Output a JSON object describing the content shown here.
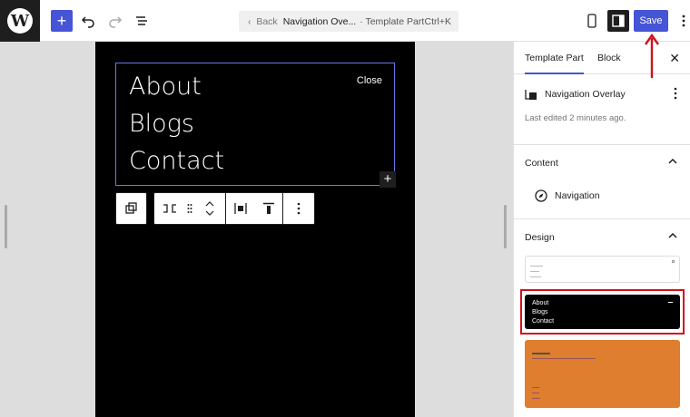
{
  "topbar": {
    "logo_letter": "W",
    "add_label": "+",
    "command": {
      "back": "Back",
      "title": "Navigation Ove...",
      "subtitle": "· Template Part",
      "shortcut": "Ctrl+K"
    },
    "save_label": "Save"
  },
  "canvas": {
    "nav_items": [
      "About",
      "Blogs",
      "Contact"
    ],
    "close_label": "Close",
    "inserter": "+"
  },
  "sidebar": {
    "tabs": [
      "Template Part",
      "Block"
    ],
    "active_tab": "Template Part",
    "close": "✕",
    "template_part_title": "Navigation Overlay",
    "last_edited": "Last edited 2 minutes ago.",
    "content_heading": "Content",
    "navigation_label": "Navigation",
    "design_heading": "Design",
    "design_black": [
      "About",
      "Blogs",
      "Contact"
    ]
  },
  "colors": {
    "accent": "#4654d6",
    "highlight": "#d0121b",
    "orange": "#e07e2f"
  },
  "icons": [
    "wordpress-logo-icon",
    "undo-icon",
    "redo-icon",
    "document-overview-icon",
    "mobile-preview-icon",
    "sidebar-toggle-icon",
    "more-options-icon",
    "navigation-compass-icon",
    "template-part-icon",
    "chevron-up-icon",
    "close-icon"
  ]
}
